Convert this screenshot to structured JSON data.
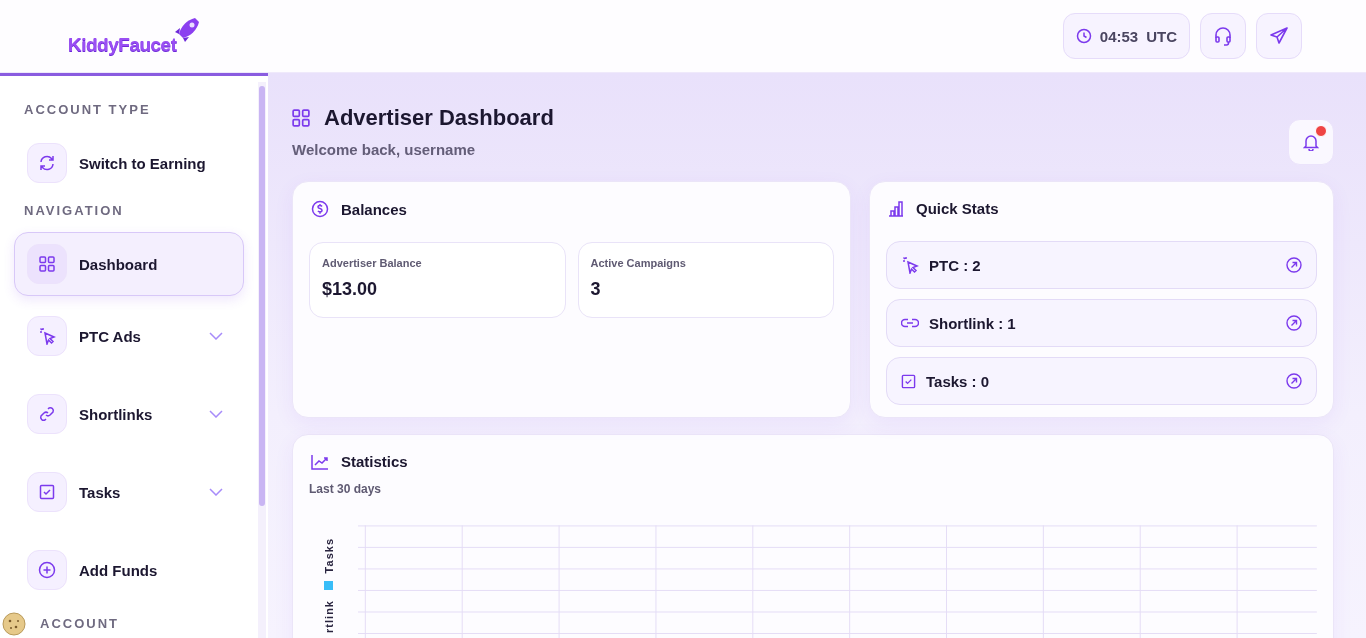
{
  "header": {
    "logo": "KiddyFaucet",
    "clock": {
      "time": "04:53",
      "zone": "UTC"
    }
  },
  "sidebar": {
    "sections": [
      {
        "title": "ACCOUNT TYPE",
        "items": [
          {
            "label": "Switch to Earning",
            "kind": "switch",
            "selected": false,
            "expandable": false
          }
        ]
      },
      {
        "title": "NAVIGATION",
        "items": [
          {
            "label": "Dashboard",
            "kind": "grid",
            "selected": true,
            "expandable": false
          },
          {
            "label": "PTC Ads",
            "kind": "cursor",
            "selected": false,
            "expandable": true
          },
          {
            "label": "Shortlinks",
            "kind": "link",
            "selected": false,
            "expandable": true
          },
          {
            "label": "Tasks",
            "kind": "check",
            "selected": false,
            "expandable": true
          },
          {
            "label": "Add Funds",
            "kind": "plus",
            "selected": false,
            "expandable": false
          }
        ]
      },
      {
        "title": "ACCOUNT"
      }
    ]
  },
  "page": {
    "title": "Advertiser Dashboard",
    "subtitle": "Welcome back, username",
    "notification_unread": true
  },
  "balances": {
    "title": "Balances",
    "items": [
      {
        "label": "Advertiser Balance",
        "value": "$13.00"
      },
      {
        "label": "Active Campaigns",
        "value": "3"
      }
    ]
  },
  "quick_stats": {
    "title": "Quick Stats",
    "items": [
      {
        "label": "PTC : 2",
        "kind": "cursor"
      },
      {
        "label": "Shortlink : 1",
        "kind": "link"
      },
      {
        "label": "Tasks : 0",
        "kind": "check"
      }
    ]
  },
  "statistics": {
    "title": "Statistics",
    "subtitle": "Last 30 days",
    "legend": [
      {
        "label": "Tasks",
        "color": "#38bdf8"
      },
      {
        "label": "rtlink"
      }
    ]
  }
}
